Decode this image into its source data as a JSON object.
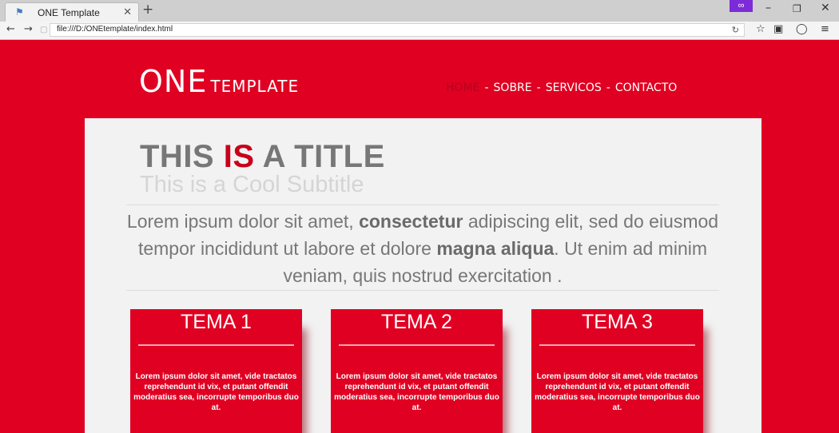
{
  "browser": {
    "tab_title": "ONE Template",
    "url": "file:///D:/ONEtemplate/index.html"
  },
  "logo": {
    "one": "ONE",
    "template": "TEMPLATE"
  },
  "nav": {
    "items": [
      "HOME",
      "SOBRE",
      "SERVICOS",
      "CONTACTO"
    ],
    "separator": "-"
  },
  "hero": {
    "title_part1": "THIS ",
    "title_highlight": "IS",
    "title_part2": " A TITLE",
    "subtitle": "This is a Cool Subtitle",
    "lede_part1": "Lorem ipsum dolor sit amet, ",
    "lede_bold1": "consectetur",
    "lede_part2": " adipiscing elit, sed do eiusmod tempor incididunt ut labore et dolore ",
    "lede_bold2": "magna aliqua",
    "lede_part3": ". Ut enim ad minim veniam, quis nostrud exercitation ."
  },
  "cards": [
    {
      "title": "TEMA 1",
      "text": "Lorem ipsum dolor sit amet, vide tractatos reprehendunt id vix, et putant offendit moderatius sea, incorrupte temporibus duo at."
    },
    {
      "title": "TEMA 2",
      "text": "Lorem ipsum dolor sit amet, vide tractatos reprehendunt id vix, et putant offendit moderatius sea, incorrupte temporibus duo at."
    },
    {
      "title": "TEMA 3",
      "text": "Lorem ipsum dolor sit amet, vide tractatos reprehendunt id vix, et putant offendit moderatius sea, incorrupte temporibus duo at."
    }
  ],
  "colors": {
    "brand_red": "#e00022",
    "highlight_red": "#c9001a",
    "panel_bg": "#f2f2f2",
    "text_gray": "#777777"
  }
}
